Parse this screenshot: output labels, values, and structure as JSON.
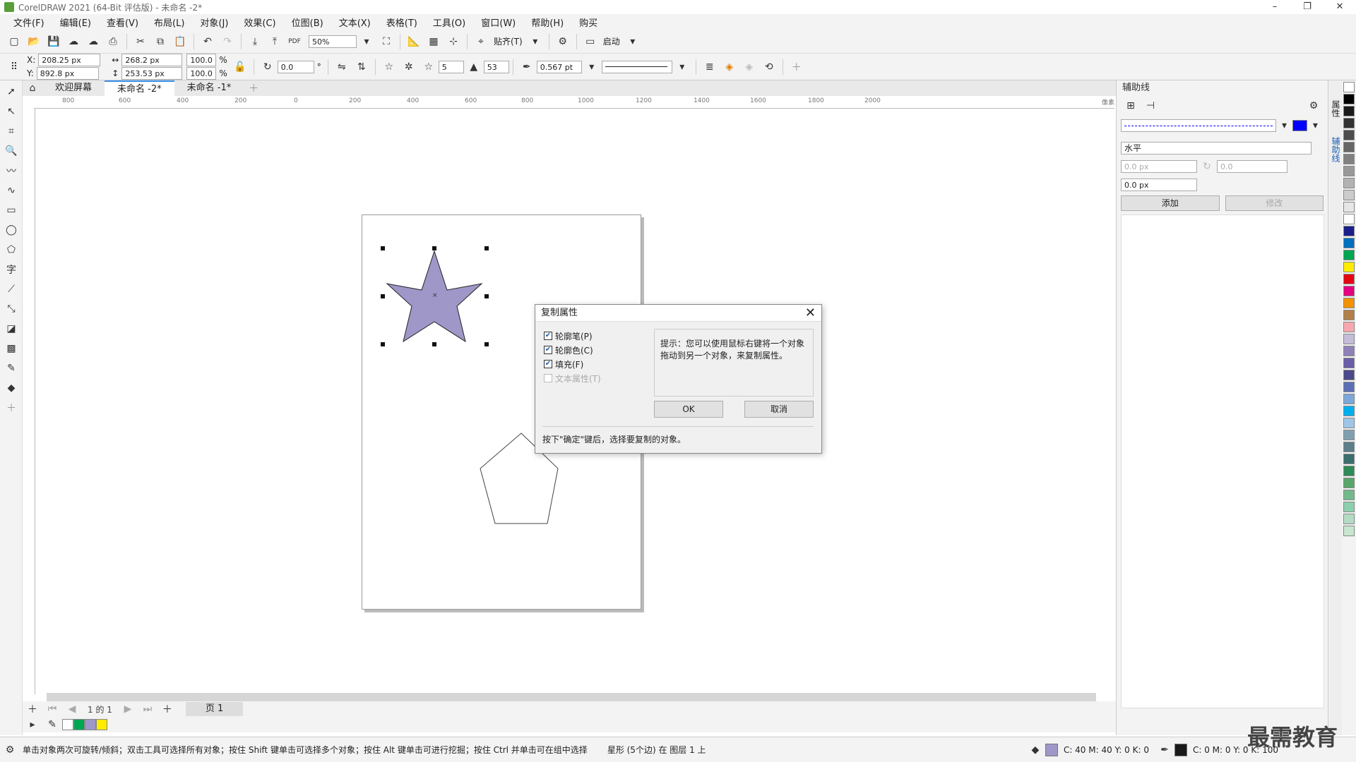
{
  "window": {
    "title": "CorelDRAW 2021 (64-Bit 评估版) - 未命名 -2*"
  },
  "menu": [
    "文件(F)",
    "编辑(E)",
    "查看(V)",
    "布局(L)",
    "对象(J)",
    "效果(C)",
    "位图(B)",
    "文本(X)",
    "表格(T)",
    "工具(O)",
    "窗口(W)",
    "帮助(H)",
    "购买"
  ],
  "toolbar": {
    "zoom": "50%",
    "snap_label": "贴齐(T)",
    "launch_label": "启动"
  },
  "propbar": {
    "x_label": "X:",
    "y_label": "Y:",
    "x": "208.25 px",
    "y": "892.8 px",
    "w": "268.2 px",
    "h": "253.53 px",
    "sx": "100.0",
    "sy": "100.0",
    "pct": "%",
    "angle": "0.0",
    "points": "5",
    "sharp": "53",
    "outline": "0.567 pt"
  },
  "tabs": [
    "欢迎屏幕",
    "未命名 -2*",
    "未命名 -1*"
  ],
  "ruler": {
    "h_labels": [
      "800",
      "600",
      "400",
      "200",
      "0",
      "200",
      "400",
      "600",
      "800",
      "1000",
      "1200",
      "1400",
      "1600",
      "1800",
      "2000"
    ],
    "unit": "像素"
  },
  "pagenav": {
    "page_info": "1 的 1",
    "page_tab": "页 1"
  },
  "dialog": {
    "title": "复制属性",
    "options": [
      {
        "label": "轮廓笔(P)",
        "checked": true,
        "enabled": true
      },
      {
        "label": "轮廓色(C)",
        "checked": true,
        "enabled": true
      },
      {
        "label": "填充(F)",
        "checked": true,
        "enabled": true
      },
      {
        "label": "文本属性(T)",
        "checked": false,
        "enabled": false
      }
    ],
    "hint": "提示：您可以使用鼠标右键将一个对象拖动到另一个对象，来复制属性。",
    "ok": "OK",
    "cancel": "取消",
    "footer": "按下\"确定\"键后，选择要复制的对象。"
  },
  "dock": {
    "title": "辅助线",
    "orientation": "水平",
    "x": "0.0 px",
    "y": "0.0 px",
    "angle": "0.0",
    "add": "添加",
    "modify": "修改",
    "side_tabs": [
      "属性",
      "辅助线"
    ]
  },
  "status": {
    "hint": "单击对象两次可旋转/倾斜；双击工具可选择所有对象；按住 Shift 键单击可选择多个对象；按住 Alt 键单击可进行挖掘；按住 Ctrl 并单击可在组中选择",
    "object": "星形 (5个边) 在 图层 1 上",
    "fill_cmyk": "C: 40 M: 40 Y: 0 K: 0",
    "outline_cmyk": "C: 0 M: 0 Y: 0 K: 100"
  },
  "watermark": "最需教育",
  "colors": {
    "star_fill": "#9e97c8",
    "accent": "#3a8ee6",
    "guide_color": "#0000ff"
  },
  "palette": [
    "#ffffff",
    "#000000",
    "#1a1a1a",
    "#333333",
    "#4d4d4d",
    "#666666",
    "#808080",
    "#999999",
    "#b3b3b3",
    "#cccccc",
    "#e6e6e6",
    "#ffffff",
    "#1b1f8a",
    "#0070c0",
    "#00a651",
    "#ffec00",
    "#e30613",
    "#e4007f",
    "#f39200",
    "#b17f4a",
    "#f7a7b0",
    "#c4bcd9",
    "#8e80b8",
    "#6a5ea8",
    "#4a4a8a",
    "#5b6fb5",
    "#7da7d9",
    "#00aeef",
    "#9fc6e7",
    "#80a0b0",
    "#5c7f8a",
    "#3b6e6e",
    "#2e8b57",
    "#5aa66a",
    "#74b98c",
    "#8ccfae",
    "#b4dcc4",
    "#c8e6d0"
  ]
}
